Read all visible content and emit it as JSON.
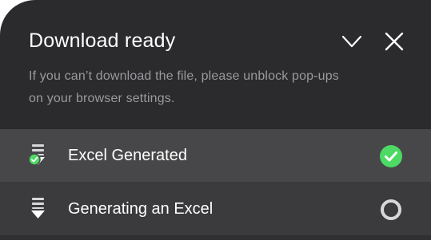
{
  "panel": {
    "title": "Download ready",
    "subtitle_line1": "If you can’t download the file, please unblock pop-ups",
    "subtitle_line2": "on your browser settings.",
    "collapse_icon": "chevron-down-icon",
    "close_icon": "close-icon"
  },
  "downloads": {
    "items": [
      {
        "label": "Excel Generated",
        "icon": "download-complete-icon",
        "status": "complete",
        "status_icon": "check-circle-icon"
      },
      {
        "label": "Generating an Excel",
        "icon": "download-icon",
        "status": "in-progress",
        "status_icon": "spinner-ring-icon"
      }
    ]
  },
  "colors": {
    "panel_bg": "#2b2b2d",
    "row_active_bg": "#474749",
    "row_bg": "#3b3b3d",
    "success": "#4cd964",
    "subtitle": "#9a9a9e",
    "text": "#ffffff"
  }
}
